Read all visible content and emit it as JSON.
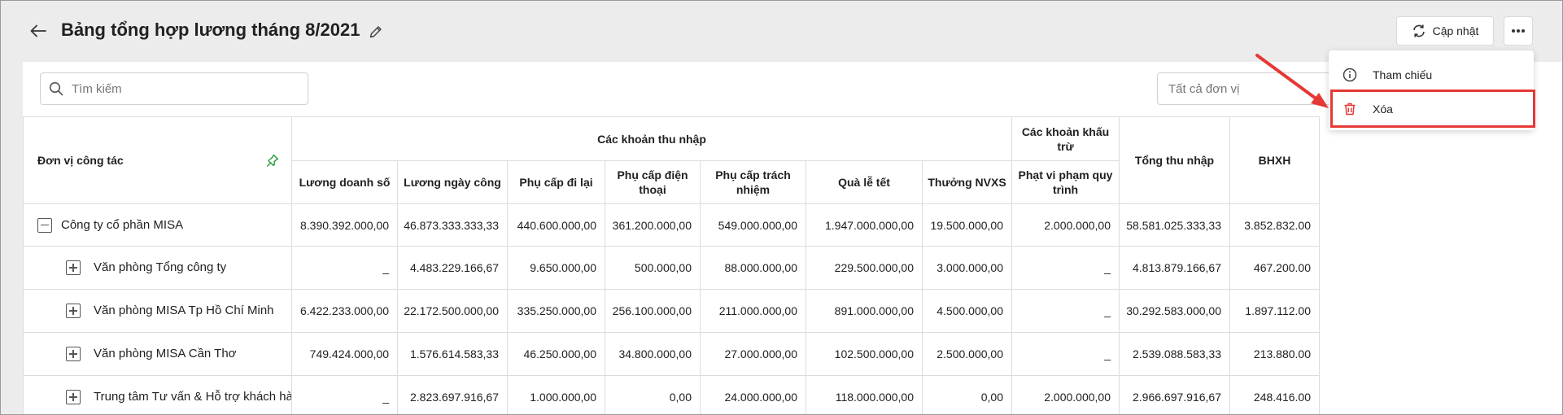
{
  "header": {
    "title": "Bảng tổng hợp lương tháng 8/2021",
    "update_label": "Cập nhật"
  },
  "toolbar": {
    "search_placeholder": "Tìm kiếm",
    "unit_filter": "Tất cả đơn vị"
  },
  "menu": {
    "items": [
      {
        "label": "Tham chiếu",
        "icon": "info-icon"
      },
      {
        "label": "Xóa",
        "icon": "trash-icon"
      }
    ]
  },
  "table": {
    "first_col_header": "Đơn vị công tác",
    "groups": {
      "income": "Các khoản thu nhập",
      "deductions": "Các khoản khấu trừ",
      "total": "Tổng thu nhập",
      "bhxh": "BHXH"
    },
    "columns": [
      "Lương doanh số",
      "Lương ngày công",
      "Phụ cấp đi lại",
      "Phụ cấp điện thoại",
      "Phụ cấp trách nhiệm",
      "Quà lễ tết",
      "Thưởng NVXS",
      "Phạt vi phạm quy trình"
    ],
    "rows": [
      {
        "name": "Công ty cổ phần MISA",
        "expanded": true,
        "cells": [
          "8.390.392.000,00",
          "46.873.333.333,33",
          "440.600.000,00",
          "361.200.000,00",
          "549.000.000,00",
          "1.947.000.000,00",
          "19.500.000,00",
          "2.000.000,00",
          "58.581.025.333,33",
          "3.852.832.00"
        ]
      },
      {
        "name": "Văn phòng Tổng công ty",
        "expanded": false,
        "cells": [
          "_",
          "4.483.229.166,67",
          "9.650.000,00",
          "500.000,00",
          "88.000.000,00",
          "229.500.000,00",
          "3.000.000,00",
          "_",
          "4.813.879.166,67",
          "467.200.00"
        ]
      },
      {
        "name": "Văn phòng MISA Tp Hồ Chí Minh",
        "expanded": false,
        "cells": [
          "6.422.233.000,00",
          "22.172.500.000,00",
          "335.250.000,00",
          "256.100.000,00",
          "211.000.000,00",
          "891.000.000,00",
          "4.500.000,00",
          "_",
          "30.292.583.000,00",
          "1.897.112.00"
        ]
      },
      {
        "name": "Văn phòng MISA Cần Thơ",
        "expanded": false,
        "cells": [
          "749.424.000,00",
          "1.576.614.583,33",
          "46.250.000,00",
          "34.800.000,00",
          "27.000.000,00",
          "102.500.000,00",
          "2.500.000,00",
          "_",
          "2.539.088.583,33",
          "213.880.00"
        ]
      },
      {
        "name": "Trung tâm Tư vấn & Hỗ trợ khách hàng",
        "expanded": false,
        "cells": [
          "_",
          "2.823.697.916,67",
          "1.000.000,00",
          "0,00",
          "24.000.000,00",
          "118.000.000,00",
          "0,00",
          "2.000.000,00",
          "2.966.697.916,67",
          "248.416.00"
        ]
      }
    ]
  },
  "colors": {
    "accent_red": "#e53935",
    "pin_green": "#2e9e48"
  }
}
